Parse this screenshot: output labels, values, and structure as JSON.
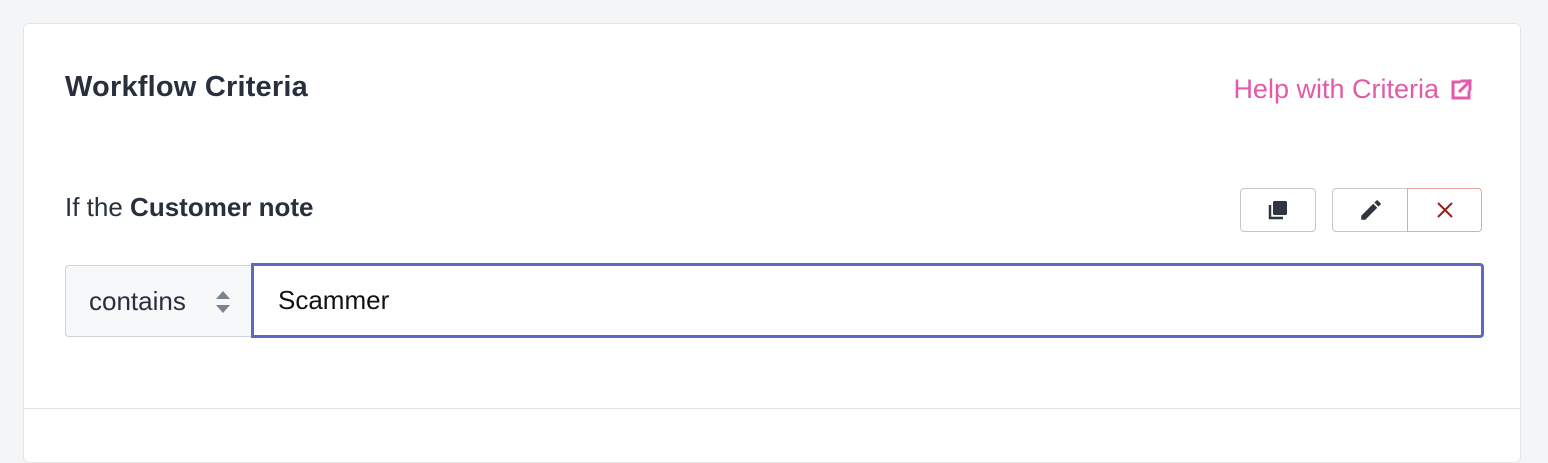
{
  "card": {
    "title": "Workflow Criteria",
    "help_link": "Help with Criteria"
  },
  "condition": {
    "prefix": "If the ",
    "field": "Customer note",
    "operator": "contains",
    "value": "Scammer"
  },
  "colors": {
    "accent": "#5c6ac4",
    "link": "#e25aa9",
    "danger": "#9b1c1c"
  }
}
